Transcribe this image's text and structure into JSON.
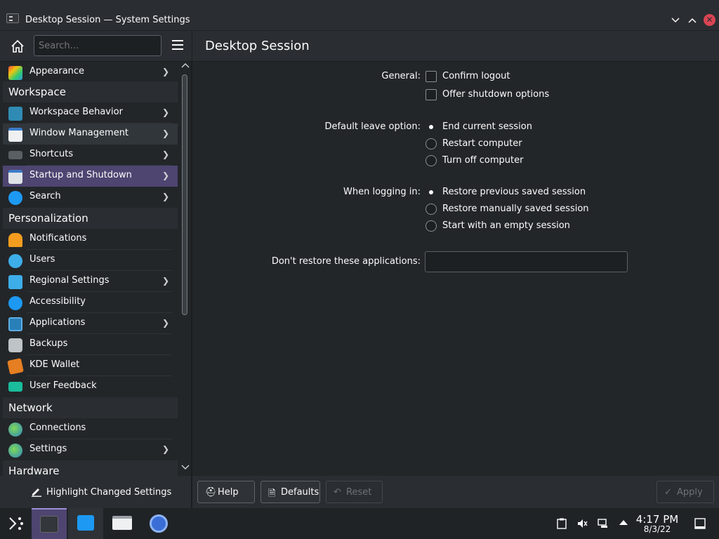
{
  "window": {
    "title": "Desktop Session — System Settings"
  },
  "search": {
    "placeholder": "Search..."
  },
  "sidebar": {
    "items": [
      {
        "label": "Appearance"
      },
      {
        "category": "Workspace"
      },
      {
        "label": "Workspace Behavior"
      },
      {
        "label": "Window Management"
      },
      {
        "label": "Shortcuts"
      },
      {
        "label": "Startup and Shutdown"
      },
      {
        "label": "Search"
      },
      {
        "category": "Personalization"
      },
      {
        "label": "Notifications"
      },
      {
        "label": "Users"
      },
      {
        "label": "Regional Settings"
      },
      {
        "label": "Accessibility"
      },
      {
        "label": "Applications"
      },
      {
        "label": "Backups"
      },
      {
        "label": "KDE Wallet"
      },
      {
        "label": "User Feedback"
      },
      {
        "category": "Network"
      },
      {
        "label": "Connections"
      },
      {
        "label": "Settings"
      },
      {
        "category": "Hardware"
      }
    ],
    "highlight_label": "Highlight Changed Settings"
  },
  "page": {
    "title": "Desktop Session",
    "general_label": "General:",
    "confirm_logout": "Confirm logout",
    "offer_shutdown": "Offer shutdown options",
    "leave_label": "Default leave option:",
    "leave_options": [
      "End current session",
      "Restart computer",
      "Turn off computer"
    ],
    "leave_selected": "End current session",
    "login_label": "When logging in:",
    "login_options": [
      "Restore previous saved session",
      "Restore manually saved session",
      "Start with an empty session"
    ],
    "login_selected": "Restore previous saved session",
    "dont_restore_label": "Don't restore these applications:",
    "dont_restore_value": ""
  },
  "footer": {
    "help": "Help",
    "defaults": "Defaults",
    "reset": "Reset",
    "apply": "Apply"
  },
  "taskbar": {
    "time": "4:17 PM",
    "date": "8/3/22"
  },
  "colors": {
    "accent": "#4e4571",
    "close": "#da4453"
  }
}
